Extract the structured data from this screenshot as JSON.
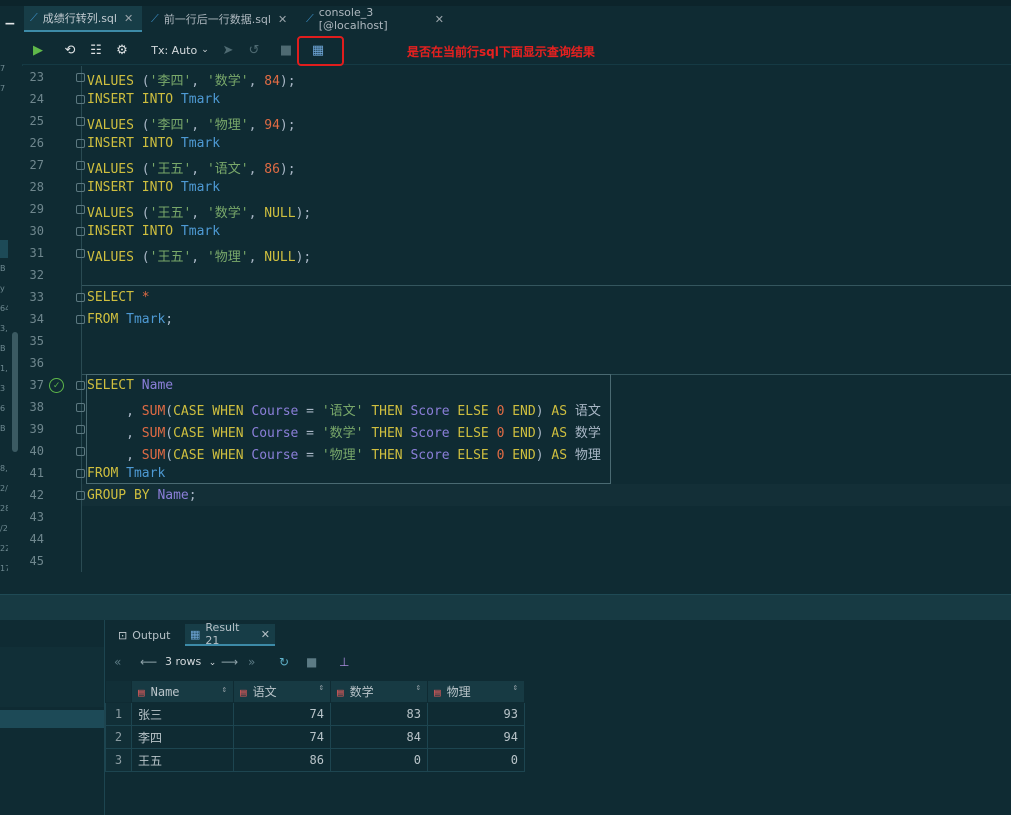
{
  "tabs": [
    {
      "label": "成绩行转列.sql",
      "active": true
    },
    {
      "label": "前一行后一行数据.sql",
      "active": false
    },
    {
      "label": "console_3 [@localhost]",
      "active": false
    }
  ],
  "toolbar": {
    "tx_label": "Tx: Auto",
    "annotation": "是否在当前行sql下面显示查询结果"
  },
  "editor": {
    "lines": [
      {
        "n": "23",
        "tokens": [
          {
            "t": "kw",
            "v": "VALUES"
          },
          {
            "t": "cm",
            "v": " ("
          },
          {
            "t": "str",
            "v": "'李四'"
          },
          {
            "t": "cm",
            "v": ", "
          },
          {
            "t": "str",
            "v": "'数学'"
          },
          {
            "t": "cm",
            "v": ", "
          },
          {
            "t": "num",
            "v": "84"
          },
          {
            "t": "cm",
            "v": ");"
          }
        ]
      },
      {
        "n": "24",
        "tokens": [
          {
            "t": "kw",
            "v": "INSERT INTO "
          },
          {
            "t": "tbl",
            "v": "Tmark"
          }
        ]
      },
      {
        "n": "25",
        "tokens": [
          {
            "t": "kw",
            "v": "VALUES"
          },
          {
            "t": "cm",
            "v": " ("
          },
          {
            "t": "str",
            "v": "'李四'"
          },
          {
            "t": "cm",
            "v": ", "
          },
          {
            "t": "str",
            "v": "'物理'"
          },
          {
            "t": "cm",
            "v": ", "
          },
          {
            "t": "num",
            "v": "94"
          },
          {
            "t": "cm",
            "v": ");"
          }
        ]
      },
      {
        "n": "26",
        "tokens": [
          {
            "t": "kw",
            "v": "INSERT INTO "
          },
          {
            "t": "tbl",
            "v": "Tmark"
          }
        ]
      },
      {
        "n": "27",
        "tokens": [
          {
            "t": "kw",
            "v": "VALUES"
          },
          {
            "t": "cm",
            "v": " ("
          },
          {
            "t": "str",
            "v": "'王五'"
          },
          {
            "t": "cm",
            "v": ", "
          },
          {
            "t": "str",
            "v": "'语文'"
          },
          {
            "t": "cm",
            "v": ", "
          },
          {
            "t": "num",
            "v": "86"
          },
          {
            "t": "cm",
            "v": ");"
          }
        ]
      },
      {
        "n": "28",
        "tokens": [
          {
            "t": "kw",
            "v": "INSERT INTO "
          },
          {
            "t": "tbl",
            "v": "Tmark"
          }
        ]
      },
      {
        "n": "29",
        "tokens": [
          {
            "t": "kw",
            "v": "VALUES"
          },
          {
            "t": "cm",
            "v": " ("
          },
          {
            "t": "str",
            "v": "'王五'"
          },
          {
            "t": "cm",
            "v": ", "
          },
          {
            "t": "str",
            "v": "'数学'"
          },
          {
            "t": "cm",
            "v": ", "
          },
          {
            "t": "kw",
            "v": "NULL"
          },
          {
            "t": "cm",
            "v": ");"
          }
        ]
      },
      {
        "n": "30",
        "tokens": [
          {
            "t": "kw",
            "v": "INSERT INTO "
          },
          {
            "t": "tbl",
            "v": "Tmark"
          }
        ]
      },
      {
        "n": "31",
        "tokens": [
          {
            "t": "kw",
            "v": "VALUES"
          },
          {
            "t": "cm",
            "v": " ("
          },
          {
            "t": "str",
            "v": "'王五'"
          },
          {
            "t": "cm",
            "v": ", "
          },
          {
            "t": "str",
            "v": "'物理'"
          },
          {
            "t": "cm",
            "v": ", "
          },
          {
            "t": "kw",
            "v": "NULL"
          },
          {
            "t": "cm",
            "v": ");"
          }
        ]
      },
      {
        "n": "32",
        "tokens": []
      },
      {
        "n": "33",
        "tokens": [
          {
            "t": "kw",
            "v": "SELECT "
          },
          {
            "t": "num",
            "v": "*"
          }
        ]
      },
      {
        "n": "34",
        "tokens": [
          {
            "t": "kw",
            "v": "FROM "
          },
          {
            "t": "tbl",
            "v": "Tmark"
          },
          {
            "t": "cm",
            "v": ";"
          }
        ]
      },
      {
        "n": "35",
        "tokens": []
      },
      {
        "n": "36",
        "tokens": []
      },
      {
        "n": "37",
        "tokens": [
          {
            "t": "kw",
            "v": "SELECT "
          },
          {
            "t": "col",
            "v": "Name"
          }
        ]
      },
      {
        "n": "38",
        "tokens": [
          {
            "t": "cm",
            "v": "     , "
          },
          {
            "t": "fn",
            "v": "SUM"
          },
          {
            "t": "cm",
            "v": "("
          },
          {
            "t": "kw",
            "v": "CASE WHEN "
          },
          {
            "t": "col",
            "v": "Course"
          },
          {
            "t": "cm",
            "v": " = "
          },
          {
            "t": "str",
            "v": "'语文'"
          },
          {
            "t": "kw",
            "v": " THEN "
          },
          {
            "t": "col",
            "v": "Score"
          },
          {
            "t": "kw",
            "v": " ELSE "
          },
          {
            "t": "num",
            "v": "0"
          },
          {
            "t": "kw",
            "v": " END"
          },
          {
            "t": "cm",
            "v": ") "
          },
          {
            "t": "kw",
            "v": "AS "
          },
          {
            "t": "cm",
            "v": "语文"
          }
        ]
      },
      {
        "n": "39",
        "tokens": [
          {
            "t": "cm",
            "v": "     , "
          },
          {
            "t": "fn",
            "v": "SUM"
          },
          {
            "t": "cm",
            "v": "("
          },
          {
            "t": "kw",
            "v": "CASE WHEN "
          },
          {
            "t": "col",
            "v": "Course"
          },
          {
            "t": "cm",
            "v": " = "
          },
          {
            "t": "str",
            "v": "'数学'"
          },
          {
            "t": "kw",
            "v": " THEN "
          },
          {
            "t": "col",
            "v": "Score"
          },
          {
            "t": "kw",
            "v": " ELSE "
          },
          {
            "t": "num",
            "v": "0"
          },
          {
            "t": "kw",
            "v": " END"
          },
          {
            "t": "cm",
            "v": ") "
          },
          {
            "t": "kw",
            "v": "AS "
          },
          {
            "t": "cm",
            "v": "数学"
          }
        ]
      },
      {
        "n": "40",
        "tokens": [
          {
            "t": "cm",
            "v": "     , "
          },
          {
            "t": "fn",
            "v": "SUM"
          },
          {
            "t": "cm",
            "v": "("
          },
          {
            "t": "kw",
            "v": "CASE WHEN "
          },
          {
            "t": "col",
            "v": "Course"
          },
          {
            "t": "cm",
            "v": " = "
          },
          {
            "t": "str",
            "v": "'物理'"
          },
          {
            "t": "kw",
            "v": " THEN "
          },
          {
            "t": "col",
            "v": "Score"
          },
          {
            "t": "kw",
            "v": " ELSE "
          },
          {
            "t": "num",
            "v": "0"
          },
          {
            "t": "kw",
            "v": " END"
          },
          {
            "t": "cm",
            "v": ") "
          },
          {
            "t": "kw",
            "v": "AS "
          },
          {
            "t": "cm",
            "v": "物理"
          }
        ]
      },
      {
        "n": "41",
        "tokens": [
          {
            "t": "kw",
            "v": "FROM "
          },
          {
            "t": "tbl",
            "v": "Tmark"
          }
        ]
      },
      {
        "n": "42",
        "tokens": [
          {
            "t": "kw",
            "v": "GROUP BY "
          },
          {
            "t": "col",
            "v": "Name"
          },
          {
            "t": "cm",
            "v": ";"
          }
        ]
      },
      {
        "n": "43",
        "tokens": []
      },
      {
        "n": "44",
        "tokens": []
      },
      {
        "n": "45",
        "tokens": []
      }
    ]
  },
  "results": {
    "tabs": [
      {
        "label": "Output",
        "active": false
      },
      {
        "label": "Result 21",
        "active": true
      }
    ],
    "rows_label": "3 rows",
    "columns": [
      "Name",
      "语文",
      "数学",
      "物理"
    ],
    "rows": [
      {
        "n": "1",
        "cells": [
          "张三",
          "74",
          "83",
          "93"
        ]
      },
      {
        "n": "2",
        "cells": [
          "李四",
          "74",
          "84",
          "94"
        ]
      },
      {
        "n": "3",
        "cells": [
          "王五",
          "86",
          "0",
          "0"
        ]
      }
    ]
  },
  "left_gutter_fragments": [
    "7",
    "7",
    "B",
    "y E",
    "64",
    "3, C",
    "B",
    "1,",
    "3",
    "6",
    "B",
    "8,",
    "2/",
    "28",
    "/2",
    "22",
    "17"
  ],
  "colors": {
    "annotation": "#e8201f",
    "accent": "#3d8ba8"
  }
}
